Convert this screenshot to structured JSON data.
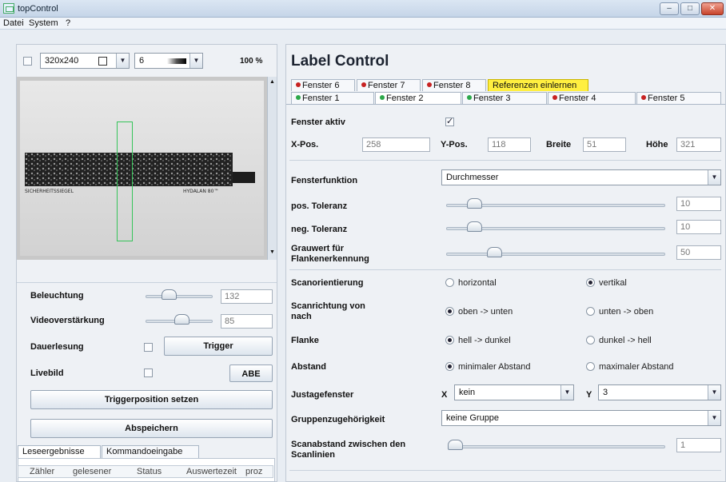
{
  "window": {
    "title": "topControl",
    "min": "–",
    "max": "□",
    "close": "✕"
  },
  "menu": [
    "Datei",
    "System",
    "?"
  ],
  "toolbar": {
    "resolution": "320x240",
    "step": "6",
    "zoom": "100 %"
  },
  "image": {
    "left_text": "SICHERHEITSSIEGEL",
    "right_text": "HYDALAN 80™"
  },
  "left": {
    "rows": [
      {
        "label": "Beleuchtung",
        "value": "132",
        "level": 0.3
      },
      {
        "label": "Videoverstärkung",
        "value": "85",
        "level": 0.55
      },
      {
        "label": "Dauerlesung",
        "button": "Trigger"
      },
      {
        "label": "Livebild",
        "button": "ABE"
      }
    ],
    "button_trigger_pos": "Triggerposition setzen",
    "button_save": "Abspeichern",
    "tabs": [
      "Leseergebnisse",
      "Kommandoeingabe"
    ],
    "table_headers": [
      "Zähler",
      "gelesener",
      "Status",
      "Auswertezeit",
      "proz"
    ]
  },
  "right": {
    "title": "Label Control",
    "tabs_top": [
      {
        "label": "Fenster 6",
        "dot": "red"
      },
      {
        "label": "Fenster 7",
        "dot": "red"
      },
      {
        "label": "Fenster 8",
        "dot": "red"
      },
      {
        "label": "Referenzen einlernen",
        "dot": ""
      }
    ],
    "tabs_bottom": [
      {
        "label": "Fenster 1",
        "dot": "green"
      },
      {
        "label": "Fenster 2",
        "dot": "green"
      },
      {
        "label": "Fenster 3",
        "dot": "green"
      },
      {
        "label": "Fenster 4",
        "dot": "red"
      },
      {
        "label": "Fenster 5",
        "dot": "red"
      }
    ],
    "fenster_aktiv": "Fenster aktiv",
    "xpos": {
      "label": "X-Pos.",
      "value": "258"
    },
    "ypos": {
      "label": "Y-Pos.",
      "value": "118"
    },
    "breite": {
      "label": "Breite",
      "value": "51"
    },
    "hoehe": {
      "label": "Höhe",
      "value": "321"
    },
    "fensterfunktion": {
      "label": "Fensterfunktion",
      "value": "Durchmesser"
    },
    "pos_tol": {
      "label": "pos. Toleranz",
      "value": "10",
      "level": 0.1
    },
    "neg_tol": {
      "label": "neg. Toleranz",
      "value": "10",
      "level": 0.1
    },
    "grauwert": {
      "label1": "Grauwert für",
      "label2": "Flankenerkennung",
      "value": "50",
      "level": 0.2
    },
    "scanorient": {
      "label": "Scanorientierung",
      "opt1": "horizontal",
      "opt2": "vertikal"
    },
    "scanrichtung": {
      "label1": "Scanrichtung von",
      "label2": "nach",
      "opt1": "oben -> unten",
      "opt2": "unten -> oben"
    },
    "flanke": {
      "label": "Flanke",
      "opt1": "hell -> dunkel",
      "opt2": "dunkel -> hell"
    },
    "abstand": {
      "label": "Abstand",
      "opt1": "minimaler Abstand",
      "opt2": "maximaler Abstand"
    },
    "justage": {
      "label": "Justagefenster",
      "x_label": "X",
      "x_value": "kein",
      "y_label": "Y",
      "y_value": "3"
    },
    "gruppe": {
      "label": "Gruppenzugehörigkeit",
      "value": "keine Gruppe"
    },
    "scanabstand": {
      "label1": "Scanabstand zwischen den",
      "label2": "Scanlinien",
      "value": "1",
      "level": 0.0
    }
  }
}
